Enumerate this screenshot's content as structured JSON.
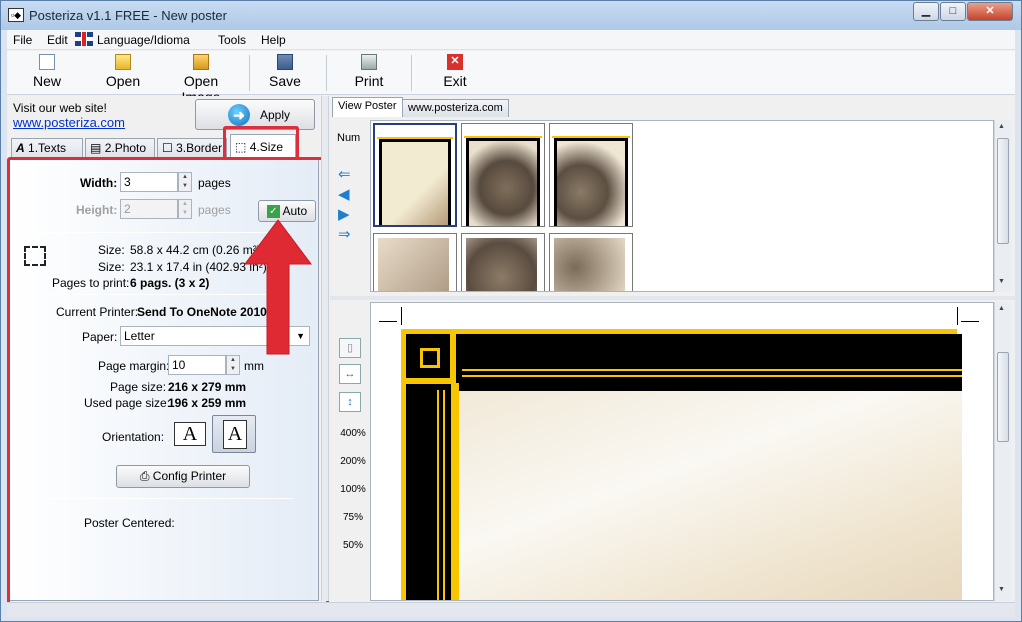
{
  "window": {
    "title": "Posteriza v1.1 FREE - New poster"
  },
  "menu": [
    "File",
    "Edit",
    "Language/Idioma",
    "Tools",
    "Help"
  ],
  "toolbar": {
    "new": "New",
    "open": "Open",
    "open_image": "Open Image",
    "save": "Save",
    "print": "Print",
    "exit": "Exit"
  },
  "left": {
    "visit": "Visit our web site!",
    "link": "www.posteriza.com",
    "apply": "Apply",
    "tabs": [
      "1.Texts",
      "2.Photo",
      "3.Border",
      "4.Size"
    ],
    "width_label": "Width:",
    "width_value": "3",
    "width_unit": "pages",
    "height_label": "Height:",
    "height_value": "2",
    "height_unit": "pages",
    "auto": "Auto",
    "size_label": "Size:",
    "size_cm": "58.8 x 44.2 cm (0.26 m²)",
    "size_in": "23.1 x 17.4 in (402.93 in²)",
    "pages_label": "Pages to print:",
    "pages_value": "6 pags. (3 x 2)",
    "printer_label": "Current Printer:",
    "printer_value": "Send To OneNote 2010",
    "paper_label": "Paper:",
    "paper_value": "Letter",
    "margin_label": "Page margin:",
    "margin_value": "10",
    "margin_unit": "mm",
    "pagesize_label": "Page size:",
    "pagesize_value": "216 x 279 mm",
    "usedsize_label": "Used page size:",
    "usedsize_value": "196 x 259 mm",
    "orientation_label": "Orientation:",
    "orient_glyph": "A",
    "config": "Config Printer",
    "centered": "Poster Centered:"
  },
  "right": {
    "tabs": [
      "View Poster",
      "www.posteriza.com"
    ],
    "num": "Num",
    "zoom": [
      "400%",
      "200%",
      "100%",
      "75%",
      "50%"
    ]
  },
  "colors": {
    "accent_red": "#dd2e3c",
    "border_gold": "#f7c600",
    "link": "#0033cc"
  }
}
